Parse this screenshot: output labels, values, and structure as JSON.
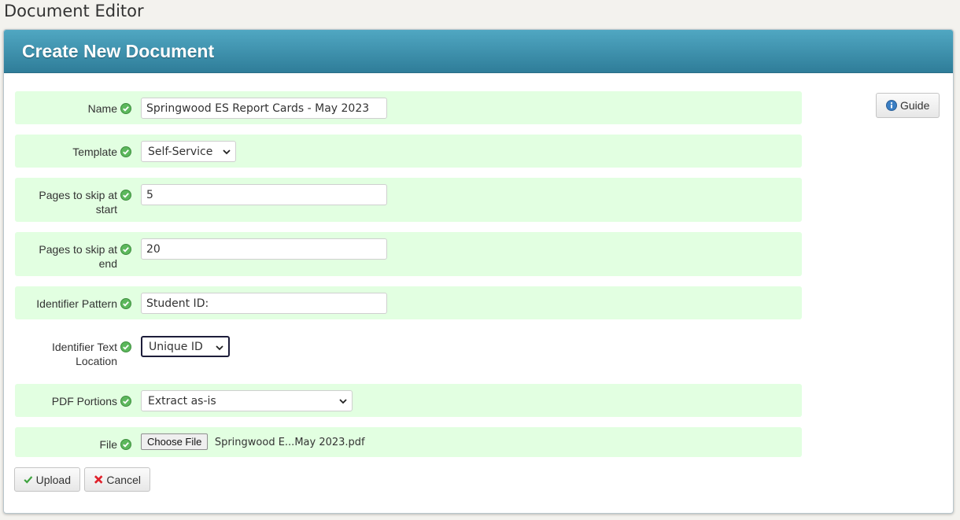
{
  "app_title": "Document Editor",
  "panel_title": "Create New Document",
  "guide_label": "Guide",
  "form": {
    "name": {
      "label": "Name",
      "value": "Springwood ES Report Cards - May 2023"
    },
    "template": {
      "label": "Template",
      "value": "Self-Service"
    },
    "skip_start": {
      "label_line1": "Pages to skip at",
      "label_line2": "start",
      "value": "5"
    },
    "skip_end": {
      "label_line1": "Pages to skip at",
      "label_line2": "end",
      "value": "20"
    },
    "identifier_pattern": {
      "label": "Identifier Pattern",
      "value": "Student ID:"
    },
    "identifier_location": {
      "label_line1": "Identifier Text",
      "label_line2": "Location",
      "value": "Unique ID"
    },
    "pdf_portions": {
      "label": "PDF Portions",
      "value": "Extract as-is"
    },
    "file": {
      "label": "File",
      "button": "Choose File",
      "filename": "Springwood E...May 2023.pdf"
    }
  },
  "actions": {
    "upload": "Upload",
    "cancel": "Cancel"
  },
  "colors": {
    "header": "#3f92ae",
    "row_bg": "#e2ffe1",
    "ok": "#5cb85c",
    "cancel": "#e0202a"
  }
}
